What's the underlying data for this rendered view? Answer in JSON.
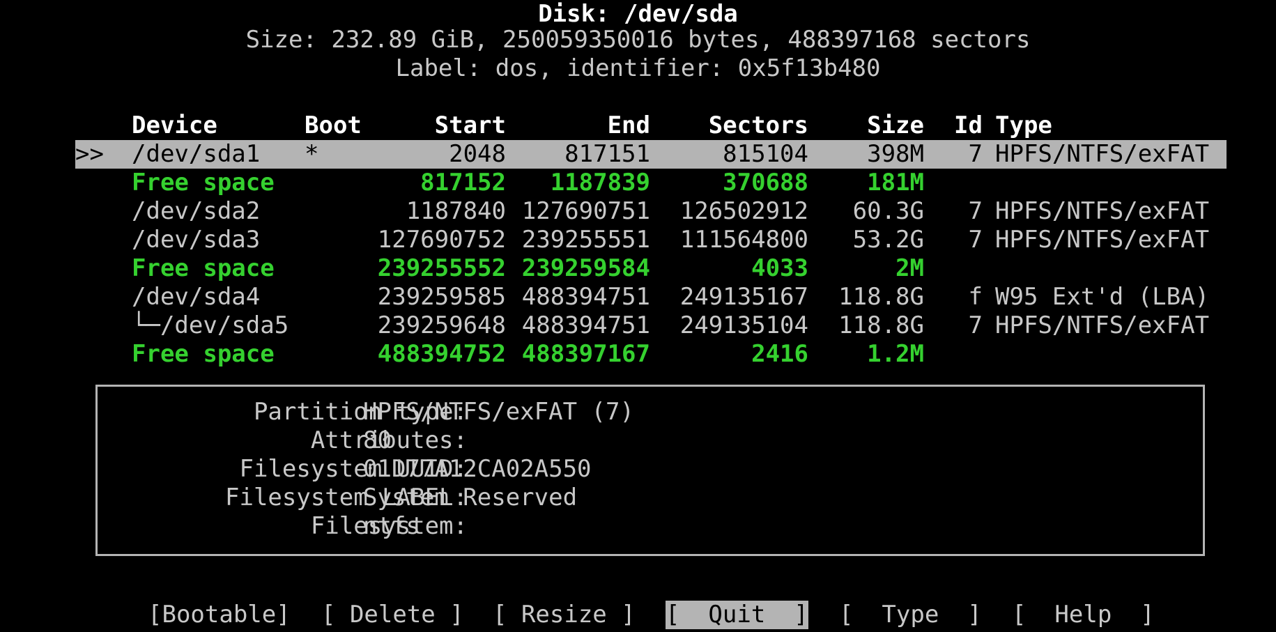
{
  "header": {
    "title": "Disk: /dev/sda",
    "size_line": "Size: 232.89 GiB, 250059350016 bytes, 488397168 sectors",
    "label_line": "Label: dos, identifier: 0x5f13b480"
  },
  "columns": {
    "device": "Device",
    "boot": "Boot",
    "start": "Start",
    "end": "End",
    "sectors": "Sectors",
    "size": "Size",
    "id": "Id",
    "type": "Type"
  },
  "selection_marker": ">>",
  "rows": [
    {
      "device": "/dev/sda1",
      "boot": "*",
      "start": "2048",
      "end": "817151",
      "sectors": "815104",
      "size": "398M",
      "id": "7",
      "type": "HPFS/NTFS/exFAT",
      "kind": "selected"
    },
    {
      "device": "Free space",
      "boot": "",
      "start": "817152",
      "end": "1187839",
      "sectors": "370688",
      "size": "181M",
      "id": "",
      "type": "",
      "kind": "free"
    },
    {
      "device": "/dev/sda2",
      "boot": "",
      "start": "1187840",
      "end": "127690751",
      "sectors": "126502912",
      "size": "60.3G",
      "id": "7",
      "type": "HPFS/NTFS/exFAT",
      "kind": "normal"
    },
    {
      "device": "/dev/sda3",
      "boot": "",
      "start": "127690752",
      "end": "239255551",
      "sectors": "111564800",
      "size": "53.2G",
      "id": "7",
      "type": "HPFS/NTFS/exFAT",
      "kind": "normal"
    },
    {
      "device": "Free space",
      "boot": "",
      "start": "239255552",
      "end": "239259584",
      "sectors": "4033",
      "size": "2M",
      "id": "",
      "type": "",
      "kind": "free"
    },
    {
      "device": "/dev/sda4",
      "boot": "",
      "start": "239259585",
      "end": "488394751",
      "sectors": "249135167",
      "size": "118.8G",
      "id": "f",
      "type": "W95 Ext'd (LBA)",
      "kind": "normal"
    },
    {
      "device": "└─/dev/sda5",
      "boot": "",
      "start": "239259648",
      "end": "488394751",
      "sectors": "249135104",
      "size": "118.8G",
      "id": "7",
      "type": "HPFS/NTFS/exFAT",
      "kind": "normal"
    },
    {
      "device": "Free space",
      "boot": "",
      "start": "488394752",
      "end": "488397167",
      "sectors": "2416",
      "size": "1.2M",
      "id": "",
      "type": "",
      "kind": "free"
    }
  ],
  "info": [
    {
      "label": "Partition type:",
      "value": "HPFS/NTFS/exFAT (7)"
    },
    {
      "label": "Attributes:",
      "value": "80"
    },
    {
      "label": "Filesystem UUID:",
      "value": "01D77A12CA02A550"
    },
    {
      "label": "Filesystem LABEL:",
      "value": "System Reserved"
    },
    {
      "label": "Filesystem:",
      "value": "ntfs"
    }
  ],
  "menu": [
    {
      "label": "[Bootable]",
      "selected": false
    },
    {
      "label": "[ Delete ]",
      "selected": false
    },
    {
      "label": "[ Resize ]",
      "selected": false
    },
    {
      "label": "[  Quit  ]",
      "selected": true
    },
    {
      "label": "[  Type  ]",
      "selected": false
    },
    {
      "label": "[  Help  ]",
      "selected": false
    }
  ],
  "colors": {
    "background": "#000000",
    "text": "#c8c8c8",
    "free_space": "#35d12f",
    "selection": "#b4b4b4"
  }
}
